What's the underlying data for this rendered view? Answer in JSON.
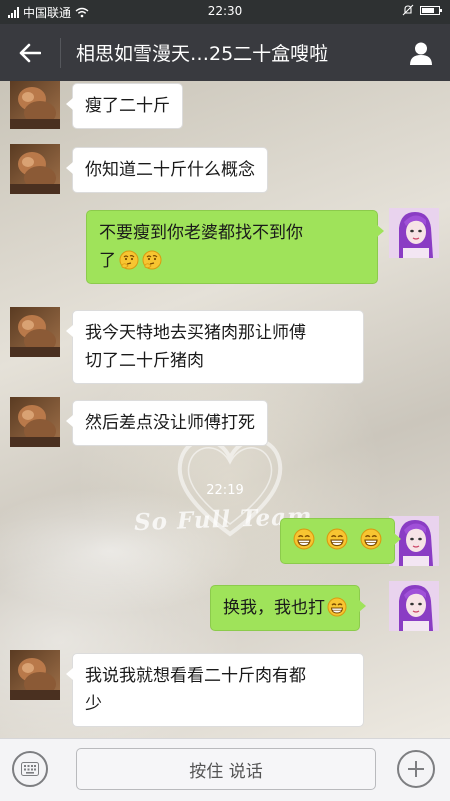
{
  "status_bar": {
    "carrier": "中国联通",
    "time": "22:30",
    "battery_level": 0.75
  },
  "nav": {
    "back_icon": "arrow-left-icon",
    "title": "相思如雪漫天…25二十盒嗖啦",
    "profile_icon": "person-icon"
  },
  "chat": {
    "timestamp": "22:19",
    "watermark": "So Full Team",
    "messages": [
      {
        "side": "in",
        "text": "瘦了二十斤"
      },
      {
        "side": "in",
        "text": "你知道二十斤什么概念"
      },
      {
        "side": "out",
        "line1": "不要瘦到你老婆都找不到你",
        "line2": "了",
        "emoji": "thinking-emoji"
      },
      {
        "side": "in",
        "line1": "我今天特地去买猪肉那让师傅",
        "line2": "切了二十斤猪肉"
      },
      {
        "side": "in",
        "text": "然后差点没让师傅打死"
      },
      {
        "side": "out",
        "emoji": "grinning-emoji"
      },
      {
        "side": "out",
        "text": "换我，我也打",
        "emoji": "grinning-emoji"
      },
      {
        "side": "in",
        "line1": "我说我就想看看二十斤肉有都",
        "line2": "少"
      }
    ]
  },
  "input_bar": {
    "keyboard_icon": "keyboard-icon",
    "hold_to_talk": "按住 说话",
    "plus_icon": "plus-icon"
  },
  "colors": {
    "nav_bg": "#393a3f",
    "out_bubble": "#9fe35a",
    "in_bubble": "#ffffff"
  }
}
